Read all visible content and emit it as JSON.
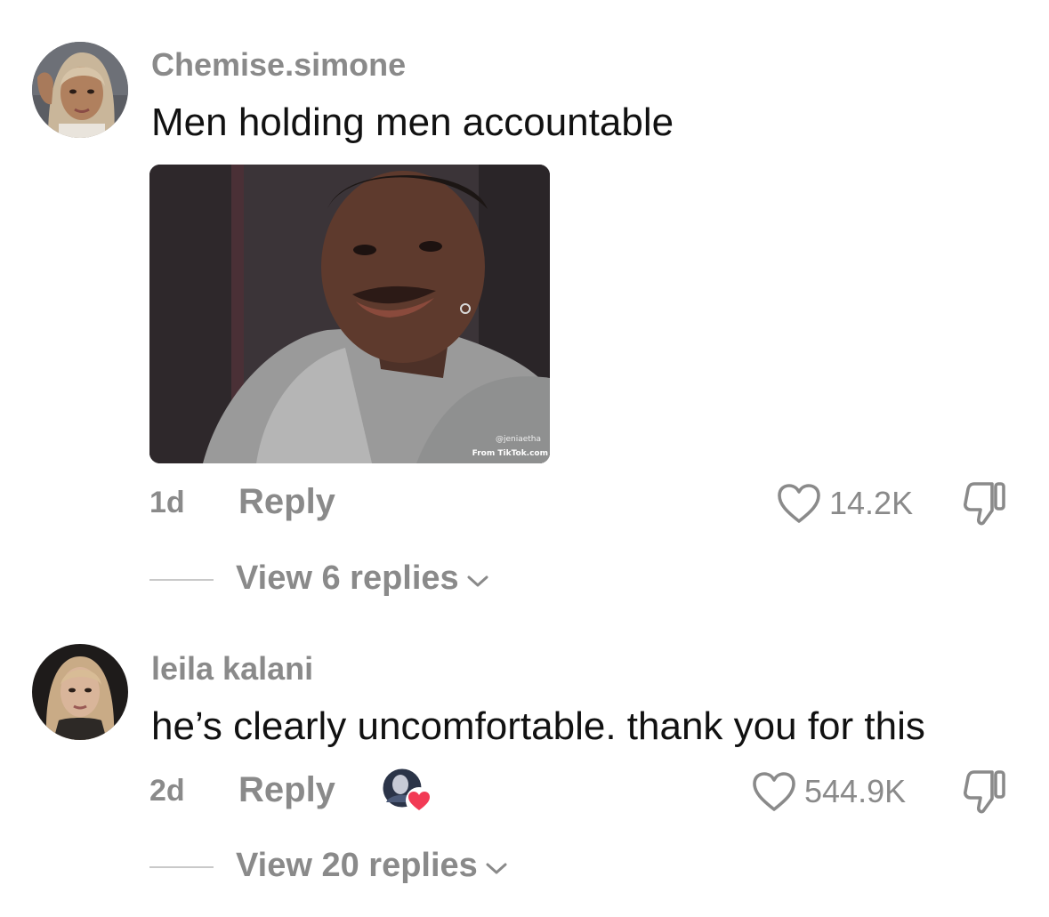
{
  "comments": [
    {
      "username": "Chemise.simone",
      "text": "Men holding men accountable",
      "gif": {
        "watermark_handle": "@jeniaetha",
        "watermark_source": "From TikTok.com"
      },
      "age": "1d",
      "reply_label": "Reply",
      "like_count": "14.2K",
      "view_replies_label": "View 6 replies"
    },
    {
      "username": "leila kalani",
      "text": "he’s clearly uncomfortable. thank you for this",
      "age": "2d",
      "reply_label": "Reply",
      "like_count": "544.9K",
      "view_replies_label": "View 20 replies"
    }
  ],
  "icons": {
    "like": "heart-outline-icon",
    "dislike": "thumbs-down-icon",
    "expand": "chevron-down-icon",
    "creator_liked": "creator-liked-heart-icon"
  },
  "colors": {
    "text_primary": "#111111",
    "text_secondary": "#8a8a8a",
    "divider": "#c9c9c9",
    "creator_heart": "#f23a55"
  }
}
